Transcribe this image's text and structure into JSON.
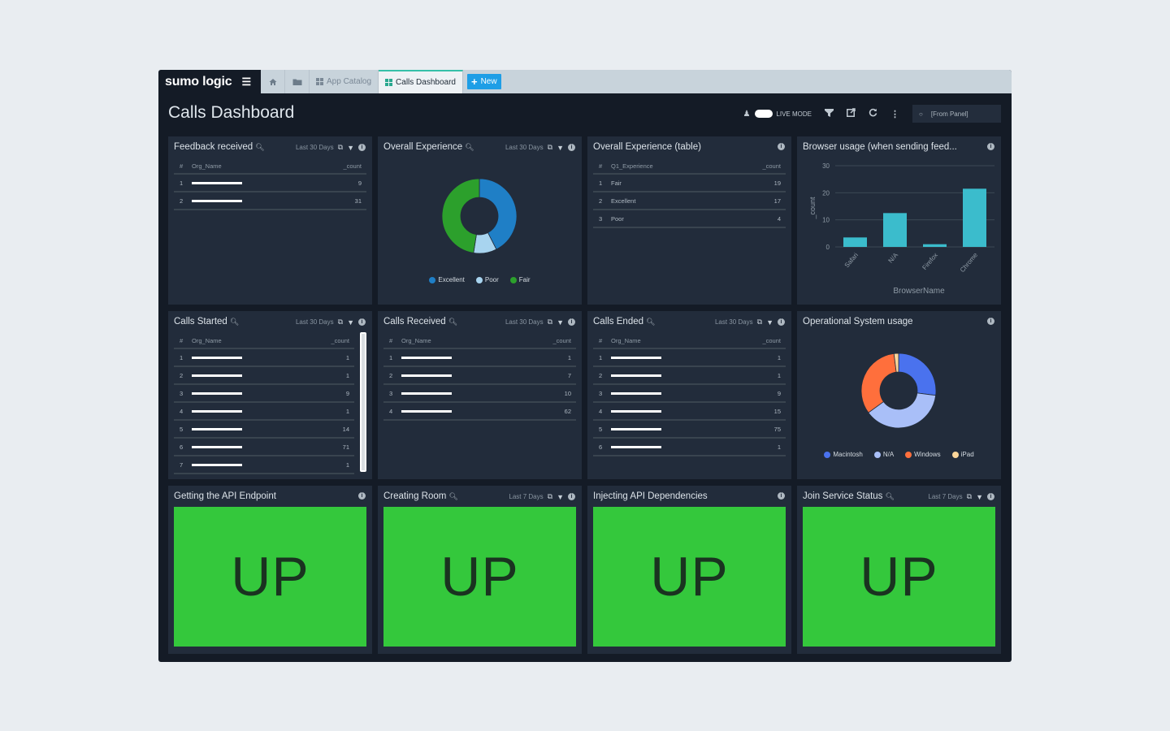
{
  "app": {
    "logo": "sumo logic",
    "menu_icon": "hamburger-icon",
    "tabs": [
      {
        "label": "",
        "icon": "home-icon"
      },
      {
        "label": "",
        "icon": "folder-icon"
      },
      {
        "label": "App Catalog",
        "icon": "grid-icon"
      },
      {
        "label": "Calls Dashboard",
        "icon": "dashboard-icon",
        "active": true
      }
    ],
    "new_button": "New"
  },
  "header": {
    "title": "Calls Dashboard",
    "live_mode_label": "LIVE MODE",
    "live_mode_on": false,
    "panel_selector": "[From Panel]"
  },
  "colors": {
    "up_green": "#34c83c",
    "accent_blue": "#1e9ee6",
    "bar_teal": "#3bbccc"
  },
  "panels": {
    "feedback_received": {
      "title": "Feedback received",
      "time_range": "Last 30 Days",
      "columns": [
        "#",
        "Org_Name",
        "_count"
      ],
      "rows": [
        {
          "n": "1",
          "count": "9"
        },
        {
          "n": "2",
          "count": "31"
        }
      ]
    },
    "overall_experience": {
      "title": "Overall Experience",
      "time_range": "Last 30 Days"
    },
    "overall_experience_table": {
      "title": "Overall Experience (table)",
      "columns": [
        "#",
        "Q1_Experience",
        "_count"
      ],
      "rows": [
        {
          "n": "1",
          "name": "Fair",
          "count": "19"
        },
        {
          "n": "2",
          "name": "Excellent",
          "count": "17"
        },
        {
          "n": "3",
          "name": "Poor",
          "count": "4"
        }
      ]
    },
    "browser_usage": {
      "title": "Browser usage (when sending feed..."
    },
    "calls_started": {
      "title": "Calls Started",
      "time_range": "Last 30 Days",
      "columns": [
        "#",
        "Org_Name",
        "_count"
      ],
      "rows": [
        {
          "n": "1",
          "count": "1"
        },
        {
          "n": "2",
          "count": "1"
        },
        {
          "n": "3",
          "count": "9"
        },
        {
          "n": "4",
          "count": "1"
        },
        {
          "n": "5",
          "count": "14"
        },
        {
          "n": "6",
          "count": "71"
        },
        {
          "n": "7",
          "count": "1"
        }
      ]
    },
    "calls_received": {
      "title": "Calls Received",
      "time_range": "Last 30 Days",
      "columns": [
        "#",
        "Org_Name",
        "_count"
      ],
      "rows": [
        {
          "n": "1",
          "count": "1"
        },
        {
          "n": "2",
          "count": "7"
        },
        {
          "n": "3",
          "count": "10"
        },
        {
          "n": "4",
          "count": "62"
        }
      ]
    },
    "calls_ended": {
      "title": "Calls Ended",
      "time_range": "Last 30 Days",
      "columns": [
        "#",
        "Org_Name",
        "_count"
      ],
      "rows": [
        {
          "n": "1",
          "count": "1"
        },
        {
          "n": "2",
          "count": "1"
        },
        {
          "n": "3",
          "count": "9"
        },
        {
          "n": "4",
          "count": "15"
        },
        {
          "n": "5",
          "count": "75"
        },
        {
          "n": "6",
          "count": "1"
        }
      ]
    },
    "os_usage": {
      "title": "Operational System usage"
    },
    "getting_api_endpoint": {
      "title": "Getting the API Endpoint",
      "status": "UP"
    },
    "creating_room": {
      "title": "Creating Room",
      "time_range": "Last 7 Days",
      "status": "UP"
    },
    "injecting_api_dependencies": {
      "title": "Injecting API Dependencies",
      "status": "UP"
    },
    "join_service_status": {
      "title": "Join Service Status",
      "time_range": "Last 7 Days",
      "status": "UP"
    }
  },
  "chart_data": [
    {
      "id": "overall_experience",
      "type": "pie",
      "donut": true,
      "title": "Overall Experience",
      "labels": [
        "Excellent",
        "Poor",
        "Fair"
      ],
      "values": [
        17,
        4,
        19
      ],
      "colors": [
        "#1f7fc6",
        "#a8d4ef",
        "#2ca02c"
      ],
      "legend": "bottom"
    },
    {
      "id": "browser_usage",
      "type": "bar",
      "title": "Browser usage (when sending feed...",
      "categories": [
        "Safari",
        "N/A",
        "Firefox",
        "Chrome"
      ],
      "values": [
        3.5,
        12.5,
        1,
        21.5
      ],
      "xlabel": "BrowserName",
      "ylabel": "_count",
      "ylim": [
        0,
        30
      ],
      "yticks": [
        "0",
        "10",
        "20",
        "30"
      ],
      "grid": true,
      "color": "#3bbccc"
    },
    {
      "id": "os_usage",
      "type": "pie",
      "donut": true,
      "title": "Operational System usage",
      "labels": [
        "Macintosh",
        "N/A",
        "Windows",
        "iPad"
      ],
      "values": [
        27,
        38,
        33,
        2
      ],
      "colors": [
        "#4a72ee",
        "#a9bff8",
        "#ff6f3c",
        "#fbd69a"
      ],
      "legend": "bottom"
    }
  ]
}
